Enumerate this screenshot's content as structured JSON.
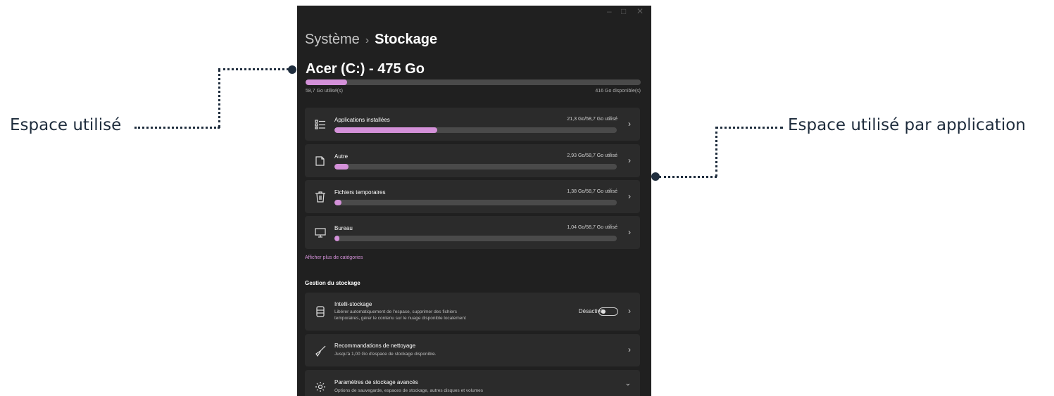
{
  "annotations": {
    "left_label": "Espace utilisé",
    "right_label": "Espace utilisé par application"
  },
  "window": {
    "controls": {
      "minimize": "–",
      "maximize": "□",
      "close": "✕"
    },
    "breadcrumb": {
      "parent": "Système",
      "separator": "›",
      "current": "Stockage"
    },
    "drive": {
      "title": "Acer (C:) - 475 Go",
      "used_label": "58,7 Go utilisé(s)",
      "free_label": "416 Go disponible(s)",
      "used_fraction": 0.124
    },
    "categories": [
      {
        "icon": "apps-list-icon",
        "label": "Applications installées",
        "usage": "21,3 Go/58,7 Go utilisé",
        "fraction": 0.363
      },
      {
        "icon": "document-icon",
        "label": "Autre",
        "usage": "2,93 Go/58,7 Go utilisé",
        "fraction": 0.05
      },
      {
        "icon": "trash-icon",
        "label": "Fichiers temporaires",
        "usage": "1,38 Go/58,7 Go utilisé",
        "fraction": 0.024
      },
      {
        "icon": "monitor-icon",
        "label": "Bureau",
        "usage": "1,04 Go/58,7 Go utilisé",
        "fraction": 0.018
      }
    ],
    "more_link": "Afficher plus de catégories",
    "management": {
      "section_title": "Gestion du stockage",
      "items": [
        {
          "icon": "storage-sense-icon",
          "title": "Intelli-stockage",
          "desc1": "Libérer automatiquement de l'espace, supprimer des fichiers",
          "desc2": "temporaires, gérer le contenu sur le nuage disponible localement",
          "toggle_label": "Désactivé",
          "toggle_on": false
        },
        {
          "icon": "broom-icon",
          "title": "Recommandations de nettoyage",
          "desc1": "Jusqu'à 1,00 Go d'espace de stockage disponible."
        },
        {
          "icon": "gear-icon",
          "title": "Paramètres de stockage avancés",
          "desc1": "Options de sauvegarde, espaces de stockage, autres disques et volumes"
        }
      ]
    }
  },
  "colors": {
    "accent": "#d491d9",
    "window_bg": "#202020",
    "card_bg": "#2b2b2b",
    "track": "#4a4a4a",
    "annotation": "#1f2d3d"
  }
}
